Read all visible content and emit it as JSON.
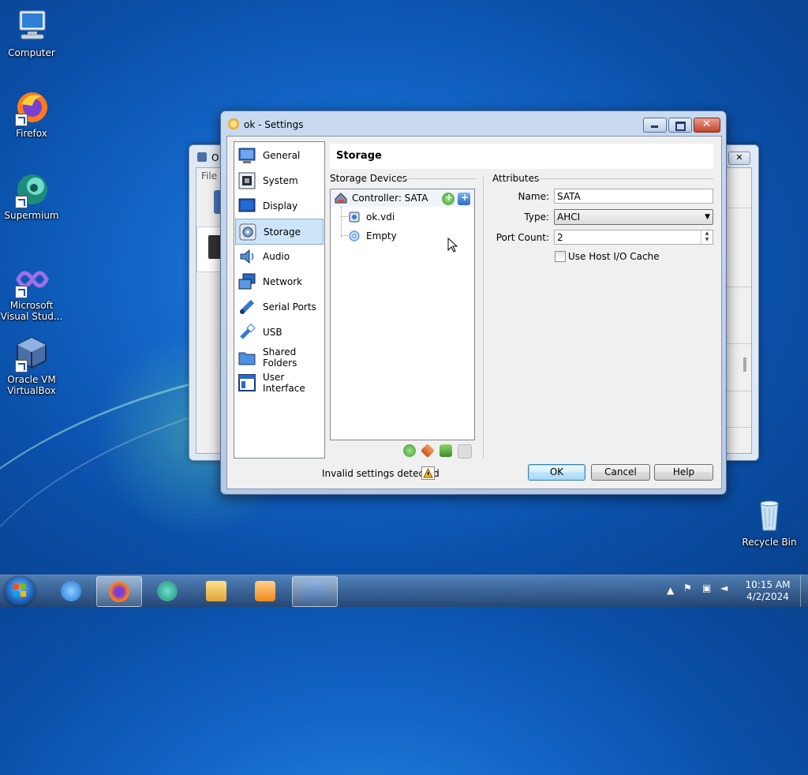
{
  "desktop": {
    "icons": [
      {
        "label": "Computer"
      },
      {
        "label": "Firefox"
      },
      {
        "label": "Supermium"
      },
      {
        "label": "Microsoft Visual Stud..."
      },
      {
        "label": "Oracle VM VirtualBox"
      },
      {
        "label": "Recycle Bin"
      }
    ]
  },
  "bg_window": {
    "title_partial": "O",
    "menu_partial": "File"
  },
  "dialog": {
    "title": "ok - Settings",
    "nav": [
      {
        "label": "General",
        "icon": "general-icon"
      },
      {
        "label": "System",
        "icon": "system-icon"
      },
      {
        "label": "Display",
        "icon": "display-icon"
      },
      {
        "label": "Storage",
        "icon": "storage-icon",
        "selected": true
      },
      {
        "label": "Audio",
        "icon": "audio-icon"
      },
      {
        "label": "Network",
        "icon": "network-icon"
      },
      {
        "label": "Serial Ports",
        "icon": "serial-ports-icon"
      },
      {
        "label": "USB",
        "icon": "usb-icon"
      },
      {
        "label": "Shared Folders",
        "icon": "shared-folders-icon"
      },
      {
        "label": "User Interface",
        "icon": "user-interface-icon"
      }
    ],
    "section_title": "Storage",
    "storage_devices_label": "Storage Devices",
    "tree": {
      "controller": "Controller: SATA",
      "items": [
        "ok.vdi",
        "Empty"
      ]
    },
    "attributes": {
      "group_label": "Attributes",
      "name_label": "Name:",
      "name_value": "SATA",
      "type_label": "Type:",
      "type_value": "AHCI",
      "port_count_label": "Port Count:",
      "port_count_value": "2",
      "host_io_cache_label": "Use Host I/O Cache",
      "host_io_cache_checked": false
    },
    "status_text": "Invalid settings detected",
    "buttons": {
      "ok": "OK",
      "cancel": "Cancel",
      "help": "Help"
    }
  },
  "taskbar": {
    "clock_time": "10:15 AM",
    "clock_date": "4/2/2024"
  }
}
